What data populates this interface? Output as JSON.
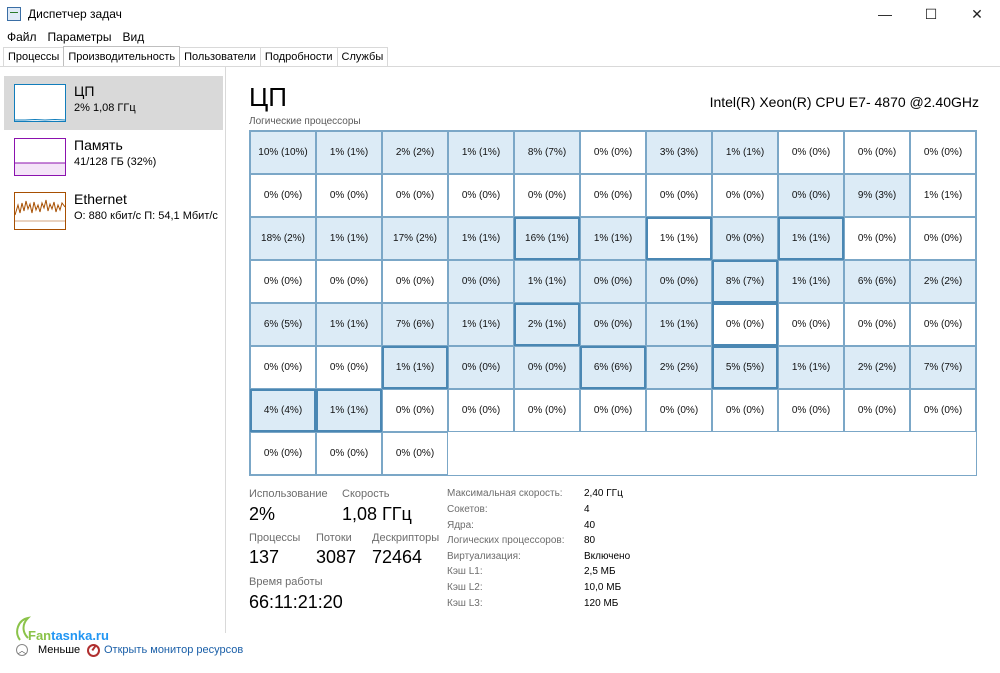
{
  "window": {
    "title": "Диспетчер задач",
    "minimize": "—",
    "maximize": "☐",
    "close": "✕"
  },
  "menu": [
    "Файл",
    "Параметры",
    "Вид"
  ],
  "tabs": [
    "Процессы",
    "Производительность",
    "Пользователи",
    "Подробности",
    "Службы"
  ],
  "active_tab": "Производительность",
  "sidebar": {
    "items": [
      {
        "name": "ЦП",
        "sub": "2% 1,08 ГГц",
        "color": "#117dbb"
      },
      {
        "name": "Память",
        "sub": "41/128 ГБ (32%)",
        "color": "#8b12ae"
      },
      {
        "name": "Ethernet",
        "sub": "О: 880 кбит/с П: 54,1 Мбит/с",
        "color": "#a74f01"
      }
    ]
  },
  "main": {
    "title": "ЦП",
    "cpu_model": "Intel(R) Xeon(R) CPU E7- 4870 @2.40GHz",
    "grid_label": "Логические процессоры",
    "cores": [
      "10% (10%)",
      "1% (1%)",
      "2% (2%)",
      "1% (1%)",
      "8% (7%)",
      "0% (0%)",
      "3% (3%)",
      "1% (1%)",
      "0% (0%)",
      "0% (0%)",
      "0% (0%)",
      "0% (0%)",
      "0% (0%)",
      "0% (0%)",
      "0% (0%)",
      "0% (0%)",
      "0% (0%)",
      "0% (0%)",
      "0% (0%)",
      "0% (0%)",
      "9% (3%)",
      "1% (1%)",
      "18% (2%)",
      "1% (1%)",
      "17% (2%)",
      "1% (1%)",
      "16% (1%)",
      "1% (1%)",
      "1% (1%)",
      "0% (0%)",
      "1% (1%)",
      "0% (0%)",
      "0% (0%)",
      "0% (0%)",
      "0% (0%)",
      "0% (0%)",
      "0% (0%)",
      "1% (1%)",
      "0% (0%)",
      "0% (0%)",
      "8% (7%)",
      "1% (1%)",
      "6% (6%)",
      "2% (2%)",
      "6% (5%)",
      "1% (1%)",
      "7% (6%)",
      "1% (1%)",
      "2% (1%)",
      "0% (0%)",
      "1% (1%)",
      "0% (0%)",
      "0% (0%)",
      "0% (0%)",
      "0% (0%)",
      "0% (0%)",
      "0% (0%)",
      "1% (1%)",
      "0% (0%)",
      "0% (0%)",
      "6% (6%)",
      "2% (2%)",
      "5% (5%)",
      "1% (1%)",
      "2% (2%)",
      "7% (7%)",
      "4% (4%)",
      "1% (1%)",
      "0% (0%)",
      "0% (0%)",
      "0% (0%)",
      "0% (0%)",
      "0% (0%)",
      "0% (0%)",
      "0% (0%)",
      "0% (0%)",
      "0% (0%)",
      "0% (0%)",
      "0% (0%)",
      "0% (0%)"
    ],
    "loaded_cells": [
      0,
      1,
      2,
      3,
      4,
      6,
      7,
      19,
      20,
      22,
      23,
      24,
      25,
      26,
      27,
      29,
      30,
      36,
      37,
      38,
      39,
      40,
      41,
      42,
      43,
      44,
      45,
      46,
      47,
      48,
      49,
      50,
      57,
      58,
      59,
      60,
      61,
      62,
      63,
      64,
      65,
      66,
      67
    ],
    "strong_cells": [
      26,
      28,
      30,
      40,
      48,
      51,
      57,
      60,
      62,
      66,
      67
    ]
  },
  "stats": {
    "usage_label": "Использование",
    "usage_value": "2%",
    "speed_label": "Скорость",
    "speed_value": "1,08 ГГц",
    "processes_label": "Процессы",
    "processes_value": "137",
    "threads_label": "Потоки",
    "threads_value": "3087",
    "handles_label": "Дескрипторы",
    "handles_value": "72464",
    "uptime_label": "Время работы",
    "uptime_value": "66:11:21:20"
  },
  "details": [
    {
      "label": "Максимальная скорость:",
      "value": "2,40 ГГц"
    },
    {
      "label": "Сокетов:",
      "value": "4"
    },
    {
      "label": "Ядра:",
      "value": "40"
    },
    {
      "label": "Логических процессоров:",
      "value": "80"
    },
    {
      "label": "Виртуализация:",
      "value": "Включено"
    },
    {
      "label": "Кэш L1:",
      "value": "2,5 МБ"
    },
    {
      "label": "Кэш L2:",
      "value": "10,0 МБ"
    },
    {
      "label": "Кэш L3:",
      "value": "120 МБ"
    }
  ],
  "footer": {
    "less_label": "Меньше",
    "resource_monitor_label": "Открыть монитор ресурсов"
  },
  "watermark": {
    "part1": "Fan",
    "part2": "tasnka.ru"
  }
}
